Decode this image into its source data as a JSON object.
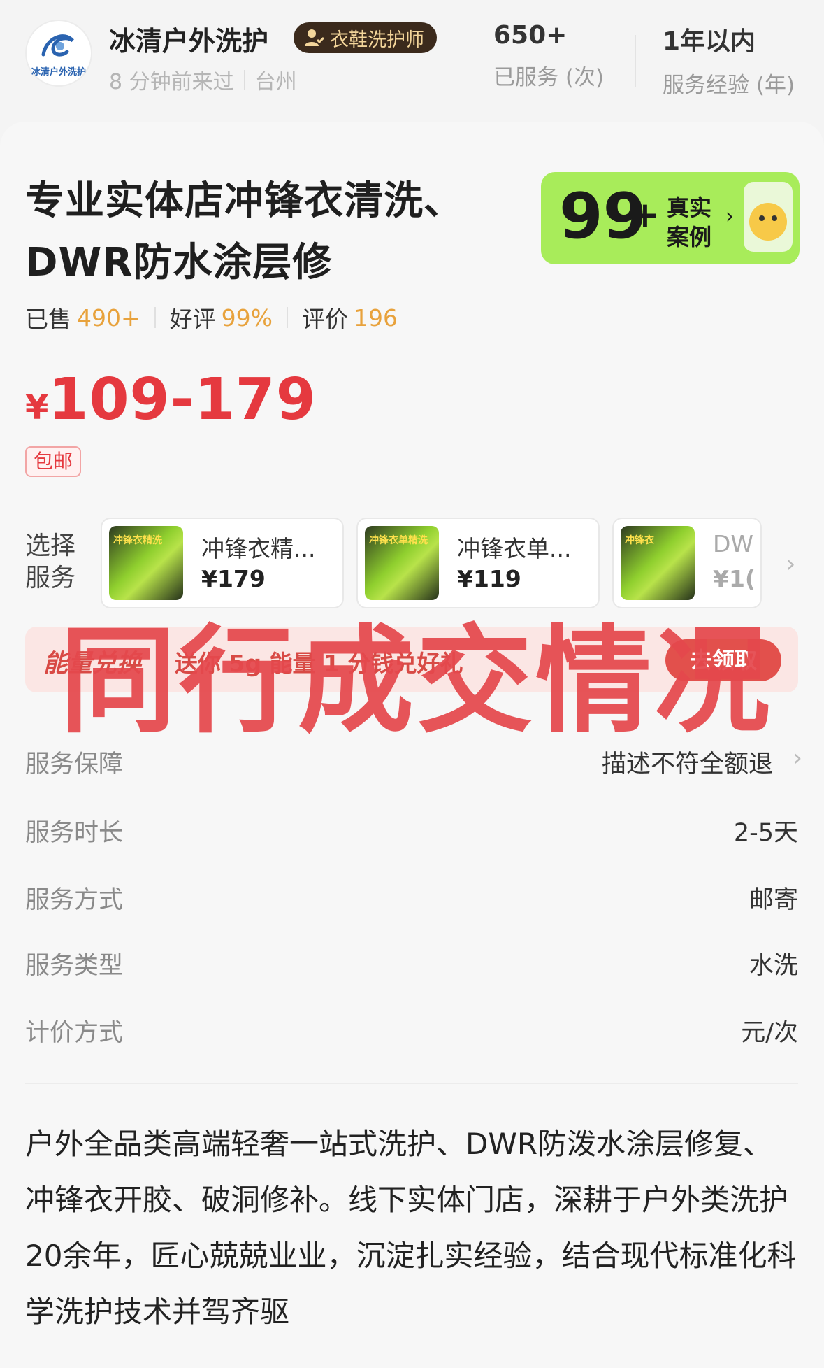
{
  "shop": {
    "logo_text": "冰清户外洗护",
    "name": "冰清户外洗护",
    "badge": "衣鞋洗护师",
    "last_visit": "8 分钟前来过",
    "city": "台州"
  },
  "stats": [
    {
      "value": "650+",
      "label": "已服务 (次)"
    },
    {
      "value": "1年以内",
      "label": "服务经验 (年)"
    }
  ],
  "product": {
    "title": "专业实体店冲锋衣清洗、DWR防水涂层修",
    "sold_label": "已售",
    "sold_value": "490+",
    "rating_label": "好评",
    "rating_value": "99%",
    "reviews_label": "评价",
    "reviews_value": "196",
    "price_currency": "¥",
    "price_range": "109-179",
    "shipping_tag": "包邮"
  },
  "cases_badge": {
    "count": "99",
    "plus": "+",
    "line1": "真实",
    "line2": "案例"
  },
  "service_select": {
    "label": "选择服务",
    "options": [
      {
        "name": "冲锋衣精...",
        "price": "¥179",
        "thumb_tag": "冲锋衣精洗"
      },
      {
        "name": "冲锋衣单...",
        "price": "¥119",
        "thumb_tag": "冲锋衣单精洗"
      },
      {
        "name": "DW",
        "price": "¥1(",
        "thumb_tag": "冲锋衣"
      }
    ]
  },
  "energy": {
    "title": "能量兑换",
    "text": "送你 5g 能量 1 分钱兑好礼",
    "button": "去领取"
  },
  "info_rows": [
    {
      "key": "服务保障",
      "value": "描述不符全额退"
    },
    {
      "key": "服务时长",
      "value": "2-5天"
    },
    {
      "key": "服务方式",
      "value": "邮寄"
    },
    {
      "key": "服务类型",
      "value": "水洗"
    },
    {
      "key": "计价方式",
      "value": "元/次"
    }
  ],
  "description": "户外全品类高端轻奢一站式洗护、DWR防泼水涂层修复、冲锋衣开胶、破洞修补。线下实体门店，深耕于户外类洗护20余年，匠心兢兢业业，沉淀扎实经验，结合现代标准化科学洗护技术并驾齐驱",
  "watermark": "同行成交情况",
  "colors": {
    "price_red": "#e5393f",
    "accent_orange": "#e8a23c",
    "cases_green": "#a8ec5a",
    "energy_bg": "#fbe6e4",
    "badge_dark": "#3b2a1c"
  }
}
